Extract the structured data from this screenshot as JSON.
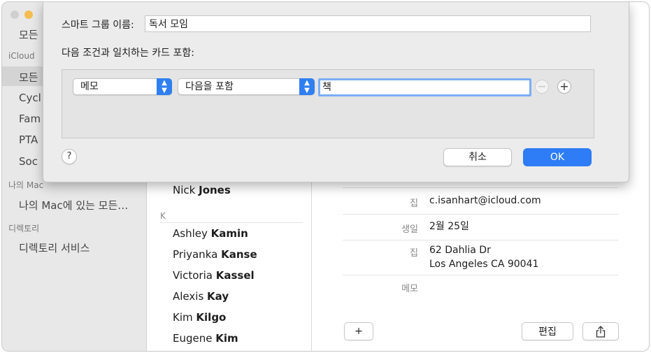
{
  "sidebar": {
    "partial_top": "모든 :",
    "icloud_header": "iCloud",
    "icloud_items": [
      "모든",
      "Cycl",
      "Fam",
      "PTA",
      "Soc"
    ],
    "mac_header": "나의 Mac",
    "mac_item": "나의 Mac에 있는 모든…",
    "directory_header": "디렉토리",
    "directory_item": "디렉토리 서비스"
  },
  "contacts": {
    "before_k": {
      "first": "Nick",
      "last": "Jones"
    },
    "section_k": "K",
    "k_list": [
      {
        "first": "Ashley",
        "last": "Kamin"
      },
      {
        "first": "Priyanka",
        "last": "Kanse"
      },
      {
        "first": "Victoria",
        "last": "Kassel"
      },
      {
        "first": "Alexis",
        "last": "Kay"
      },
      {
        "first": "Kim",
        "last": "Kilgo"
      },
      {
        "first": "Eugene",
        "last": "Kim"
      }
    ]
  },
  "detail": {
    "email_label": "집",
    "email_value": "c.isanhart@icloud.com",
    "birthday_label": "생일",
    "birthday_value": "2월 25일",
    "address_label": "집",
    "address_line1": "62 Dahlia Dr",
    "address_line2": "Los Angeles CA 90041",
    "memo_label": "메모",
    "add_button": "+",
    "edit_button": "편집",
    "share_icon": "share-icon"
  },
  "sheet": {
    "group_name_label": "스마트 그룹 이름:",
    "group_name_value": "독서 모임",
    "condition_header": "다음 조건과 일치하는 카드 포함:",
    "field_popup": "메모",
    "operator_popup": "다음을 포함",
    "value_input": "책",
    "remove_rule": "−",
    "add_rule": "+",
    "help": "?",
    "cancel": "취소",
    "ok": "OK"
  },
  "colors": {
    "accent": "#2e7cf6",
    "sidebar_bg": "#e8e8e8",
    "sheet_bg": "#ececec"
  }
}
